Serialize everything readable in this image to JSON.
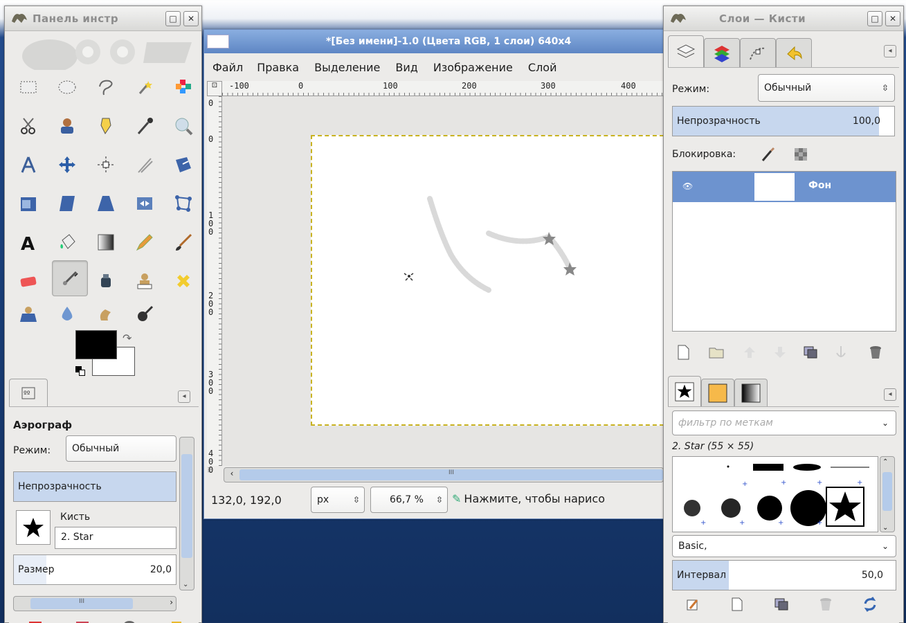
{
  "toolbox": {
    "title": "Панель инстр",
    "tool_options": {
      "tool_name": "Аэрограф",
      "mode_label": "Режим:",
      "mode_value": "Обычный",
      "opacity_label": "Непрозрачность",
      "brush_label": "Кисть",
      "brush_value": "2. Star",
      "size_label": "Размер",
      "size_value": "20,0"
    },
    "hscroll_thumb": "III"
  },
  "image_window": {
    "title": "*[Без имени]-1.0 (Цвета RGB, 1 слои) 640x4",
    "menu": [
      "Файл",
      "Правка",
      "Выделение",
      "Вид",
      "Изображение",
      "Слой"
    ],
    "ruler_h_labels": [
      "-100",
      "0",
      "100",
      "200",
      "300",
      "400"
    ],
    "ruler_v_labels": [
      "0",
      "0",
      "1\n0\n0",
      "2\n0\n0",
      "3\n0\n0",
      "4\n0\n0"
    ],
    "status": {
      "coords": "132,0, 192,0",
      "unit": "px",
      "zoom": "66,7 %",
      "message": "Нажмите, чтобы нарисо"
    },
    "scroll_thumb": "III"
  },
  "layers_dock": {
    "title": "Слои — Кисти",
    "mode_label": "Режим:",
    "mode_value": "Обычный",
    "opacity_label": "Непрозрачность",
    "opacity_value": "100,0",
    "lock_label": "Блокировка:",
    "layers": [
      {
        "name": "Фон"
      }
    ],
    "brush_filter_placeholder": "фильтр по меткам",
    "brush_selected": "2. Star (55 × 55)",
    "brush_tag": "Basic,",
    "spacing_label": "Интервал",
    "spacing_value": "50,0",
    "spacing_fraction": 0.25
  },
  "colors": {
    "accent": "#b4cbea",
    "selection": "#6d93cf",
    "desktop": "#1a3f79",
    "panel": "#ecebe9"
  }
}
